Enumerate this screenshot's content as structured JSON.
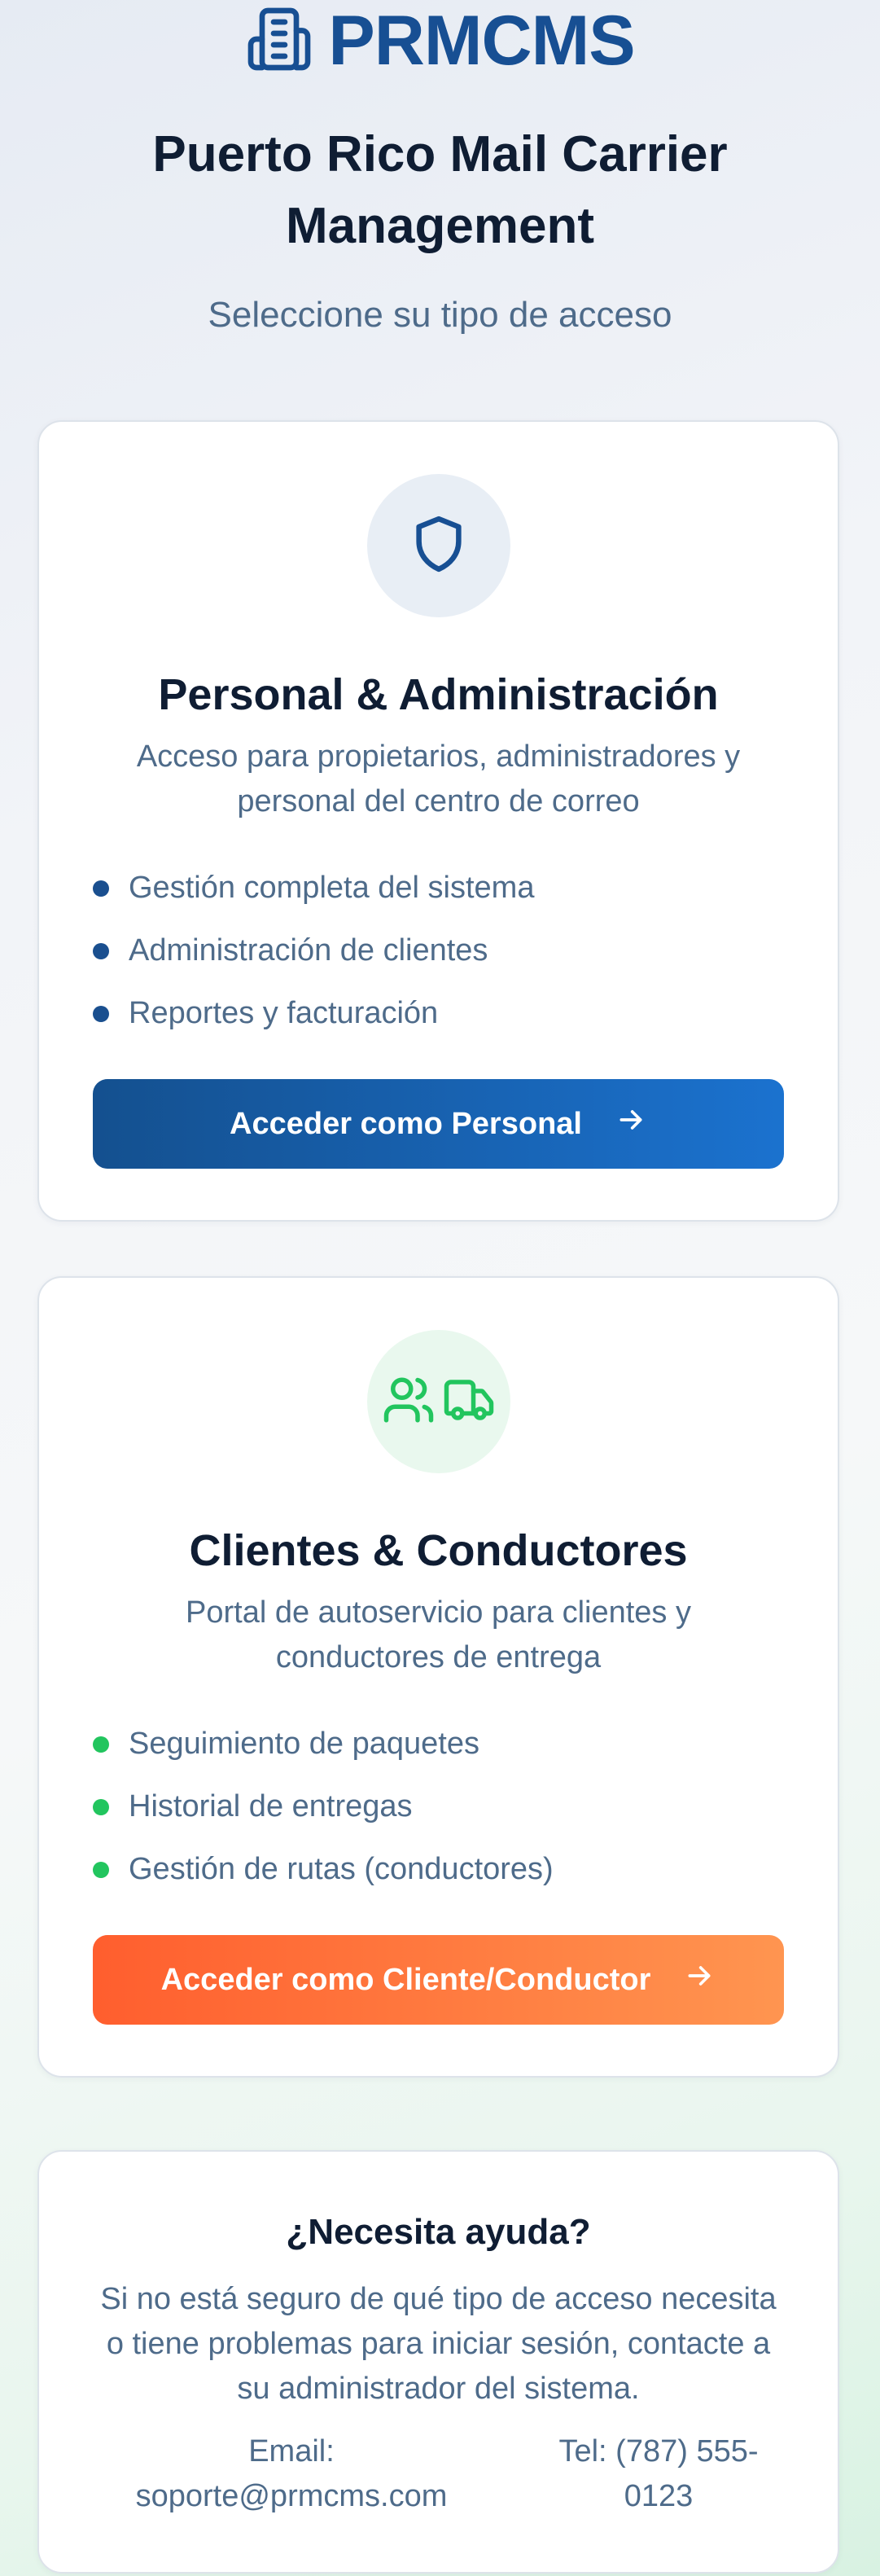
{
  "brand": {
    "name": "PRMCMS"
  },
  "header": {
    "title": "Puerto Rico Mail Carrier Management",
    "subtitle": "Seleccione su tipo de acceso"
  },
  "staff_card": {
    "title": "Personal & Administración",
    "description": "Acceso para propietarios, administradores y personal del centro de correo",
    "features": [
      "Gestión completa del sistema",
      "Administración de clientes",
      "Reportes y facturación"
    ],
    "button_label": "Acceder como Personal",
    "icon": "shield-icon",
    "accent": "#174f93",
    "bullet_color": "#1a4f8f"
  },
  "client_card": {
    "title": "Clientes & Conductores",
    "description": "Portal de autoservicio para clientes y conductores de entrega",
    "features": [
      "Seguimiento de paquetes",
      "Historial de entregas",
      "Gestión de rutas (conductores)"
    ],
    "button_label": "Acceder como Cliente/Conductor",
    "icons": [
      "users-icon",
      "truck-icon"
    ],
    "accent": "#ff6a33",
    "bullet_color": "#22c55e"
  },
  "help": {
    "title": "¿Necesita ayuda?",
    "text": "Si no está seguro de qué tipo de acceso necesita o tiene problemas para iniciar sesión, contacte a su administrador del sistema.",
    "email_label": "Email:",
    "email": "soporte@prmcms.com",
    "phone": "Tel: (787) 555-0123"
  }
}
